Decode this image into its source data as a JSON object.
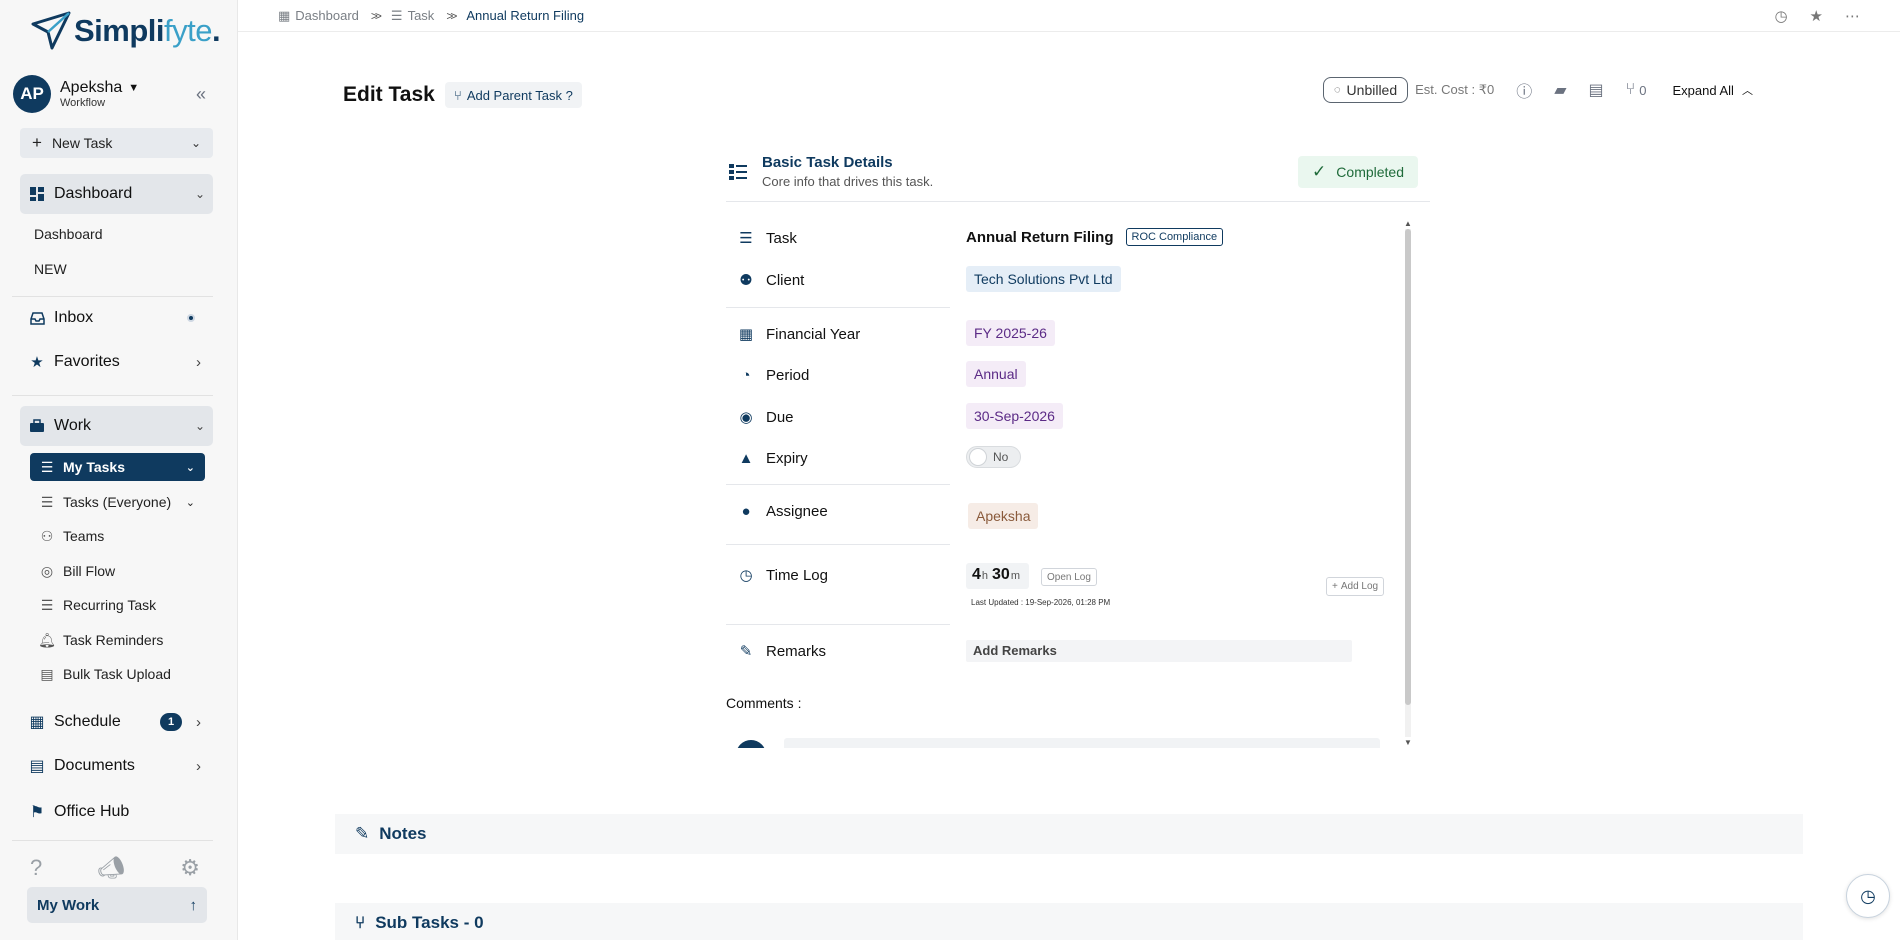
{
  "brand": {
    "name_primary": "Simpli",
    "name_secondary": "fyte",
    "dot": "."
  },
  "user": {
    "initials": "AP",
    "name": "Apeksha",
    "subtitle": "Workflow"
  },
  "sidebar": {
    "new_task": "New Task",
    "dashboard": {
      "label": "Dashboard",
      "items": [
        "Dashboard",
        "NEW"
      ]
    },
    "inbox": "Inbox",
    "favorites": "Favorites",
    "work": {
      "label": "Work",
      "items": [
        "My Tasks",
        "Tasks (Everyone)",
        "Teams",
        "Bill Flow",
        "Recurring Task",
        "Task Reminders",
        "Bulk Task Upload"
      ]
    },
    "schedule": {
      "label": "Schedule",
      "count": "1"
    },
    "documents": "Documents",
    "office_hub": "Office Hub",
    "my_work": "My Work"
  },
  "breadcrumb": [
    "Dashboard",
    "Task",
    "Annual Return Filing"
  ],
  "header": {
    "title": "Edit Task",
    "add_parent": "Add Parent Task ?",
    "billing_status": "Unbilled",
    "est_cost": "Est. Cost : ₹0",
    "subtask_count": "0",
    "expand_all": "Expand All"
  },
  "card": {
    "title": "Basic Task Details",
    "subtitle": "Core info that drives this task.",
    "status": "Completed",
    "labels": {
      "task": "Task",
      "client": "Client",
      "financial_year": "Financial Year",
      "period": "Period",
      "due": "Due",
      "expiry": "Expiry",
      "assignee": "Assignee",
      "time_log": "Time Log",
      "remarks": "Remarks"
    },
    "values": {
      "task": "Annual Return Filing",
      "task_tag": "ROC Compliance",
      "client": "Tech Solutions Pvt Ltd",
      "financial_year": "FY 2025-26",
      "period": "Annual",
      "due": "30-Sep-2026",
      "expiry": "No",
      "assignee": "Apeksha",
      "time_hours": "4",
      "time_hours_unit": "h",
      "time_minutes": "30",
      "time_minutes_unit": "m",
      "open_log": "Open Log",
      "last_updated": "Last Updated : 19-Sep-2026, 01:28 PM",
      "add_log": "Add Log",
      "remarks_placeholder": "Add Remarks"
    },
    "comments_label": "Comments :"
  },
  "sections": {
    "notes": "Notes",
    "subtasks": "Sub Tasks - 0"
  },
  "colors": {
    "brand": "#0f3a5f",
    "accent": "#3aa0c8",
    "completed": "#1f6b3a"
  }
}
